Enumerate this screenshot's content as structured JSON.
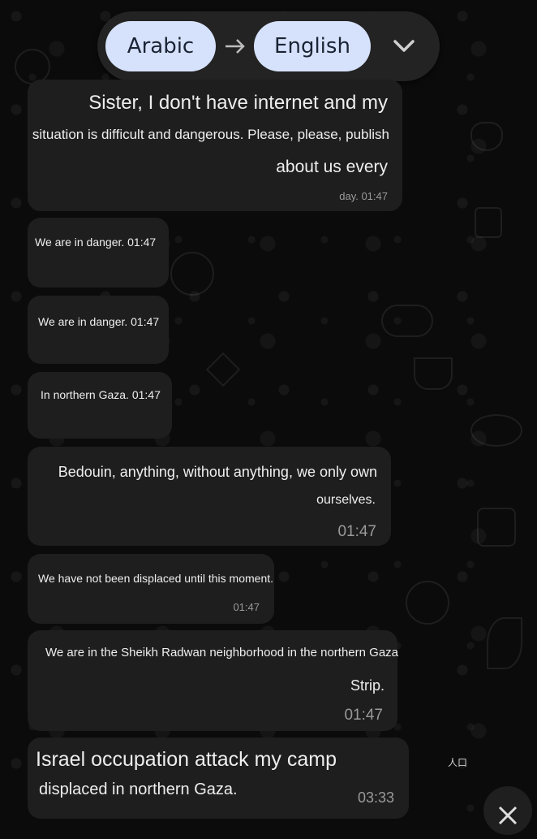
{
  "translate_bar": {
    "source_language": "Arabic",
    "target_language": "English",
    "arrow_icon": "arrow-right-icon",
    "expand_icon": "chevron-down-icon"
  },
  "messages": [
    {
      "lines": [
        "Sister, I don't have internet and my",
        "situation is difficult and dangerous. Please, please, publish",
        "about us every"
      ],
      "time": "day. 01:47"
    },
    {
      "text": "We are in danger. 01:47"
    },
    {
      "text": "We are in danger. 01:47"
    },
    {
      "text": "In northern Gaza. 01:47"
    },
    {
      "lines": [
        "Bedouin, anything, without anything, we only own",
        "ourselves."
      ],
      "time": "01:47"
    },
    {
      "lines": [
        "We have not been displaced until this moment."
      ],
      "time": "01:47"
    },
    {
      "lines": [
        "We are in the Sheikh Radwan neighborhood in the northern Gaza",
        "Strip."
      ],
      "time": "01:47"
    },
    {
      "lines": [
        "Israel occupation attack my camp",
        "displaced in northern Gaza."
      ],
      "time": "03:33"
    }
  ],
  "side_note": "人口",
  "colors": {
    "background": "#0b0b0b",
    "bubble": "#1e1e1e",
    "language_pill": "#d6e2fb",
    "translate_bar": "#232323"
  }
}
